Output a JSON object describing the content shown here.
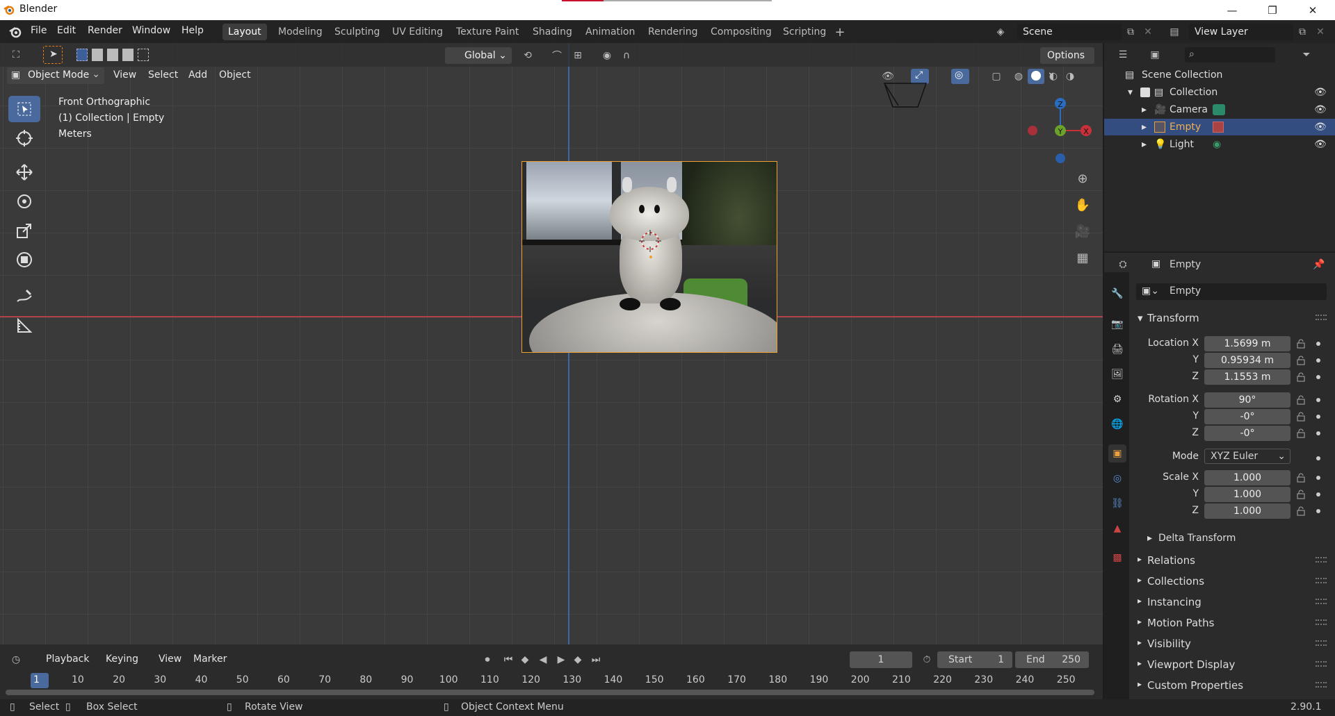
{
  "window": {
    "title": "Blender"
  },
  "menu": {
    "file": "File",
    "edit": "Edit",
    "render": "Render",
    "window": "Window",
    "help": "Help"
  },
  "workspaces": [
    "Layout",
    "Modeling",
    "Sculpting",
    "UV Editing",
    "Texture Paint",
    "Shading",
    "Animation",
    "Rendering",
    "Compositing",
    "Scripting"
  ],
  "scene": {
    "name": "Scene",
    "view_layer": "View Layer"
  },
  "viewport": {
    "mode": "Object Mode",
    "view": "View",
    "select": "Select",
    "add": "Add",
    "object": "Object",
    "orientation": "Global",
    "options": "Options",
    "info_line1": "Front Orthographic",
    "info_line2": "(1) Collection | Empty",
    "info_line3": "Meters",
    "gizmo": {
      "z": "Z",
      "y": "Y",
      "x": "X"
    }
  },
  "timeline": {
    "playback": "Playback",
    "keying": "Keying",
    "view": "View",
    "marker": "Marker",
    "current_frame": "1",
    "start_label": "Start",
    "start": "1",
    "end_label": "End",
    "end": "250",
    "ticks": [
      "1",
      "10",
      "20",
      "30",
      "40",
      "50",
      "60",
      "70",
      "80",
      "90",
      "100",
      "110",
      "120",
      "130",
      "140",
      "150",
      "160",
      "170",
      "180",
      "190",
      "200",
      "210",
      "220",
      "230",
      "240",
      "250"
    ]
  },
  "status": {
    "select": "Select",
    "box_select": "Box Select",
    "rotate": "Rotate View",
    "context": "Object Context Menu",
    "version": "2.90.1"
  },
  "outliner": {
    "scene_collection": "Scene Collection",
    "collection": "Collection",
    "items": [
      "Camera",
      "Empty",
      "Light"
    ]
  },
  "properties": {
    "header_name": "Empty",
    "object_name": "Empty",
    "transform": "Transform",
    "location_label": "Location X",
    "loc_x": "1.5699 m",
    "loc_y": "0.95934 m",
    "loc_z": "1.1553 m",
    "rotation_label": "Rotation X",
    "rot_x": "90°",
    "rot_y": "-0°",
    "rot_z": "-0°",
    "mode_label": "Mode",
    "mode": "XYZ Euler",
    "scale_label": "Scale X",
    "scale_x": "1.000",
    "scale_y": "1.000",
    "scale_z": "1.000",
    "y": "Y",
    "z": "Z",
    "delta": "Delta Transform",
    "panels": [
      "Relations",
      "Collections",
      "Instancing",
      "Motion Paths",
      "Visibility",
      "Viewport Display",
      "Custom Properties"
    ]
  },
  "colors": {
    "accent": "#4a6a9d",
    "selection": "#334d80",
    "x_axis": "#c8303a",
    "z_axis": "#2a6cc0",
    "y_axis": "#6aa22a"
  }
}
